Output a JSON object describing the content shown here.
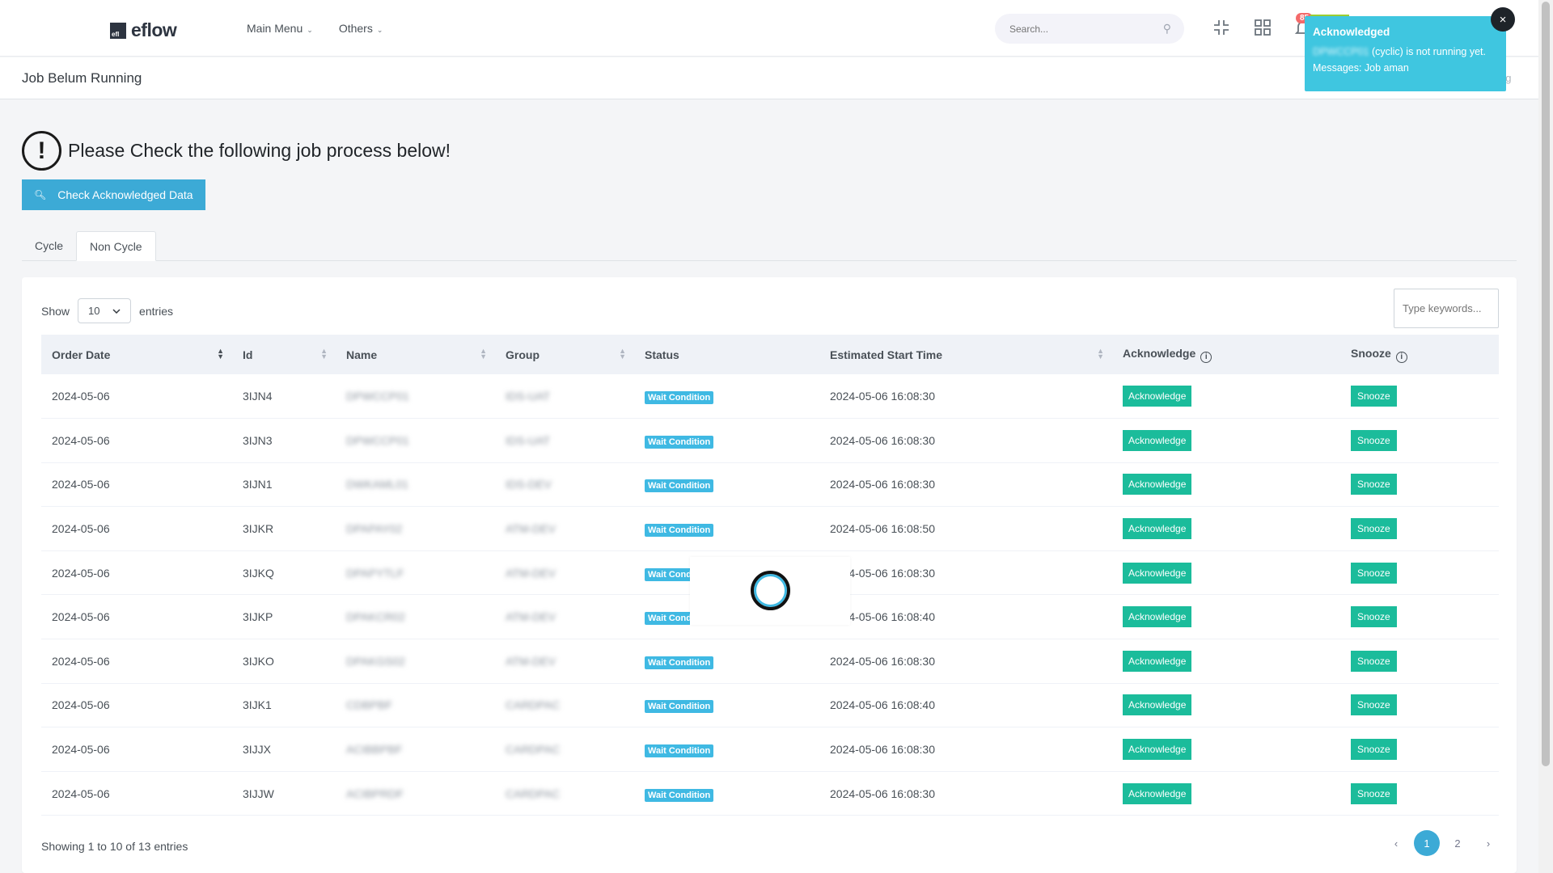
{
  "header": {
    "logo_badge": "efl",
    "logo_text": "eflow",
    "menu": [
      {
        "label": "Main Menu"
      },
      {
        "label": "Others"
      }
    ],
    "search_placeholder": "Search...",
    "notif_count": "85"
  },
  "page": {
    "title": "Job Belum Running",
    "breadcrumb_tail": "ng"
  },
  "warning": {
    "icon": "!",
    "text": "Please Check the following job process below!"
  },
  "check_button": {
    "label": "Check Acknowledged Data"
  },
  "tabs": [
    {
      "label": "Cycle",
      "active": false
    },
    {
      "label": "Non Cycle",
      "active": true
    }
  ],
  "table_controls": {
    "show_label": "Show",
    "entries_value": "10",
    "entries_label": "entries",
    "filter_placeholder": "Type keywords..."
  },
  "columns": [
    "Order Date",
    "Id",
    "Name",
    "Group",
    "Status",
    "Estimated Start Time",
    "Acknowledge",
    "Snooze"
  ],
  "rows": [
    {
      "date": "2024-05-06",
      "id": "3IJN4",
      "name": "DPWCCP01",
      "group": "IDS-UAT",
      "status": "Wait Condition",
      "est": "2024-05-06 16:08:30",
      "ack": "Acknowledge",
      "snooze": "Snooze"
    },
    {
      "date": "2024-05-06",
      "id": "3IJN3",
      "name": "DPWCCP01",
      "group": "IDS-UAT",
      "status": "Wait Condition",
      "est": "2024-05-06 16:08:30",
      "ack": "Acknowledge",
      "snooze": "Snooze"
    },
    {
      "date": "2024-05-06",
      "id": "3IJN1",
      "name": "DWKAML01",
      "group": "IDS-DEV",
      "status": "Wait Condition",
      "est": "2024-05-06 16:08:30",
      "ack": "Acknowledge",
      "snooze": "Snooze"
    },
    {
      "date": "2024-05-06",
      "id": "3IJKR",
      "name": "DPAPAY02",
      "group": "ATM-DEV",
      "status": "Wait Condition",
      "est": "2024-05-06 16:08:50",
      "ack": "Acknowledge",
      "snooze": "Snooze"
    },
    {
      "date": "2024-05-06",
      "id": "3IJKQ",
      "name": "DPAPYTLF",
      "group": "ATM-DEV",
      "status": "Wait Condition",
      "est": "2024-05-06 16:08:30",
      "ack": "Acknowledge",
      "snooze": "Snooze"
    },
    {
      "date": "2024-05-06",
      "id": "3IJKP",
      "name": "DPAKCR02",
      "group": "ATM-DEV",
      "status": "Wait Condition",
      "est": "2024-05-06 16:08:40",
      "ack": "Acknowledge",
      "snooze": "Snooze"
    },
    {
      "date": "2024-05-06",
      "id": "3IJKO",
      "name": "DPAKGS02",
      "group": "ATM-DEV",
      "status": "Wait Condition",
      "est": "2024-05-06 16:08:30",
      "ack": "Acknowledge",
      "snooze": "Snooze"
    },
    {
      "date": "2024-05-06",
      "id": "3IJK1",
      "name": "CDBPBF",
      "group": "CARDPAC",
      "status": "Wait Condition",
      "est": "2024-05-06 16:08:40",
      "ack": "Acknowledge",
      "snooze": "Snooze"
    },
    {
      "date": "2024-05-06",
      "id": "3IJJX",
      "name": "ACIBBPBF",
      "group": "CARDPAC",
      "status": "Wait Condition",
      "est": "2024-05-06 16:08:30",
      "ack": "Acknowledge",
      "snooze": "Snooze"
    },
    {
      "date": "2024-05-06",
      "id": "3IJJW",
      "name": "ACIBPRDF",
      "group": "CARDPAC",
      "status": "Wait Condition",
      "est": "2024-05-06 16:08:30",
      "ack": "Acknowledge",
      "snooze": "Snooze"
    }
  ],
  "footer": {
    "info": "Showing 1 to 10 of 13 entries",
    "prev": "‹",
    "pages": [
      "1",
      "2"
    ],
    "next": "›"
  },
  "toast": {
    "title": "Acknowledged",
    "job_name": "DPWCCP01",
    "line1_rest": " (cyclic) is not running yet.",
    "line2": "Messages: Job aman",
    "close": "×"
  },
  "colors": {
    "primary": "#3caad6",
    "success": "#1bbc9b",
    "status": "#3fb9e3",
    "toast": "#3fc6e0"
  }
}
